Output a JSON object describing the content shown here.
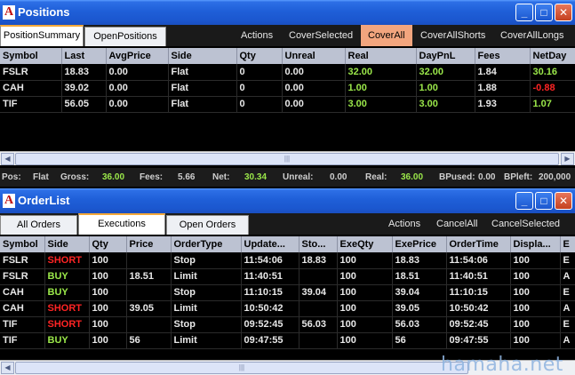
{
  "positions_window": {
    "title": "Positions",
    "app_icon": "A",
    "tabs": [
      "PositionSummary",
      "OpenPositions"
    ],
    "actions": [
      "Actions",
      "CoverSelected",
      "CoverAll",
      "CoverAllShorts",
      "CoverAllLongs"
    ],
    "columns": [
      "Symbol",
      "Last",
      "AvgPrice",
      "Side",
      "Qty",
      "Unreal",
      "Real",
      "DayPnL",
      "Fees",
      "NetDay"
    ],
    "rows": [
      [
        "FSLR",
        "18.83",
        "0.00",
        "Flat",
        "0",
        "0.00",
        "32.00",
        "32.00",
        "1.84",
        "30.16"
      ],
      [
        "CAH",
        "39.02",
        "0.00",
        "Flat",
        "0",
        "0.00",
        "1.00",
        "1.00",
        "1.88",
        "-0.88"
      ],
      [
        "TIF",
        "56.05",
        "0.00",
        "Flat",
        "0",
        "0.00",
        "3.00",
        "3.00",
        "1.93",
        "1.07"
      ]
    ]
  },
  "status": {
    "pos_label": "Pos:",
    "pos_value": "Flat",
    "gross_label": "Gross:",
    "gross_value": "36.00",
    "fees_label": "Fees:",
    "fees_value": "5.66",
    "net_label": "Net:",
    "net_value": "30.34",
    "unreal_label": "Unreal:",
    "unreal_value": "0.00",
    "real_label": "Real:",
    "real_value": "36.00",
    "bpused_label": "BPused:",
    "bpused_value": "0.00",
    "bpleft_label": "BPleft:",
    "bpleft_value": "200,000"
  },
  "orderlist_window": {
    "title": "OrderList",
    "app_icon": "A",
    "tabs": [
      "All Orders",
      "Executions",
      "Open Orders"
    ],
    "actions": [
      "Actions",
      "CancelAll",
      "CancelSelected"
    ],
    "columns": [
      "Symbol",
      "Side",
      "Qty",
      "Price",
      "OrderType",
      "Update...",
      "Sto...",
      "ExeQty",
      "ExePrice",
      "OrderTime",
      "Displa...",
      "E"
    ],
    "rows": [
      [
        "FSLR",
        "SHORT",
        "100",
        "",
        "Stop",
        "11:54:06",
        "18.83",
        "100",
        "18.83",
        "11:54:06",
        "100",
        "E"
      ],
      [
        "FSLR",
        "BUY",
        "100",
        "18.51",
        "Limit",
        "11:40:51",
        "",
        "100",
        "18.51",
        "11:40:51",
        "100",
        "A"
      ],
      [
        "CAH",
        "BUY",
        "100",
        "",
        "Stop",
        "11:10:15",
        "39.04",
        "100",
        "39.04",
        "11:10:15",
        "100",
        "E"
      ],
      [
        "CAH",
        "SHORT",
        "100",
        "39.05",
        "Limit",
        "10:50:42",
        "",
        "100",
        "39.05",
        "10:50:42",
        "100",
        "A"
      ],
      [
        "TIF",
        "SHORT",
        "100",
        "",
        "Stop",
        "09:52:45",
        "56.03",
        "100",
        "56.03",
        "09:52:45",
        "100",
        "E"
      ],
      [
        "TIF",
        "BUY",
        "100",
        "56",
        "Limit",
        "09:47:55",
        "",
        "100",
        "56",
        "09:47:55",
        "100",
        "A"
      ]
    ]
  },
  "watermark": "hamaha.net",
  "colors": {
    "positive": "#9be84a",
    "negative": "#ff2424",
    "highlight_action": "#f2a57e",
    "titlebar": "#1f5fd8"
  }
}
